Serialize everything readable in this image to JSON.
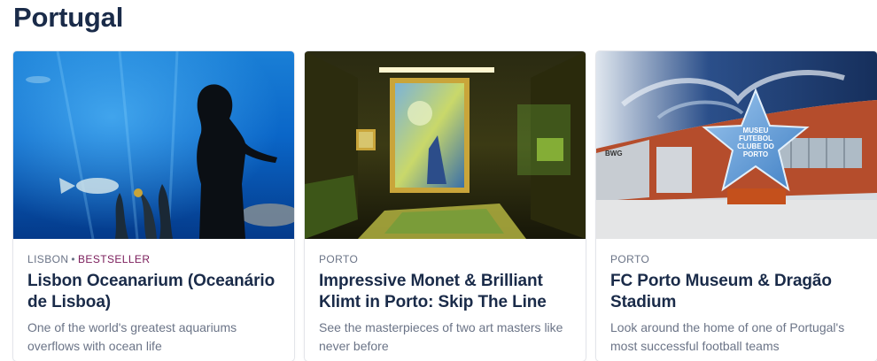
{
  "section": {
    "title": "Portugal"
  },
  "cards": [
    {
      "location": "LISBON",
      "separator": "•",
      "badge": "BESTSELLER",
      "title": "Lisbon Oceanarium (Oceanário de Lisboa)",
      "description": "One of the world's greatest aquariums overflows with ocean life",
      "image": "aquarium-silhouette-photo"
    },
    {
      "location": "PORTO",
      "title": "Impressive Monet & Brilliant Klimt in Porto: Skip The Line",
      "description": "See the masterpieces of two art masters like never before",
      "image": "immersive-art-gallery-photo"
    },
    {
      "location": "PORTO",
      "title": "FC Porto Museum & Dragão Stadium",
      "description": "Look around the home of one of Portugal's most successful football teams",
      "image": "stadium-star-monument-photo",
      "star_text": [
        "MUSEU",
        "FUTEBOL",
        "CLUBE DO",
        "PORTO"
      ]
    }
  ],
  "colors": {
    "heading": "#1a2b49",
    "meta": "#6b7487",
    "badge": "#7a1b5a"
  }
}
